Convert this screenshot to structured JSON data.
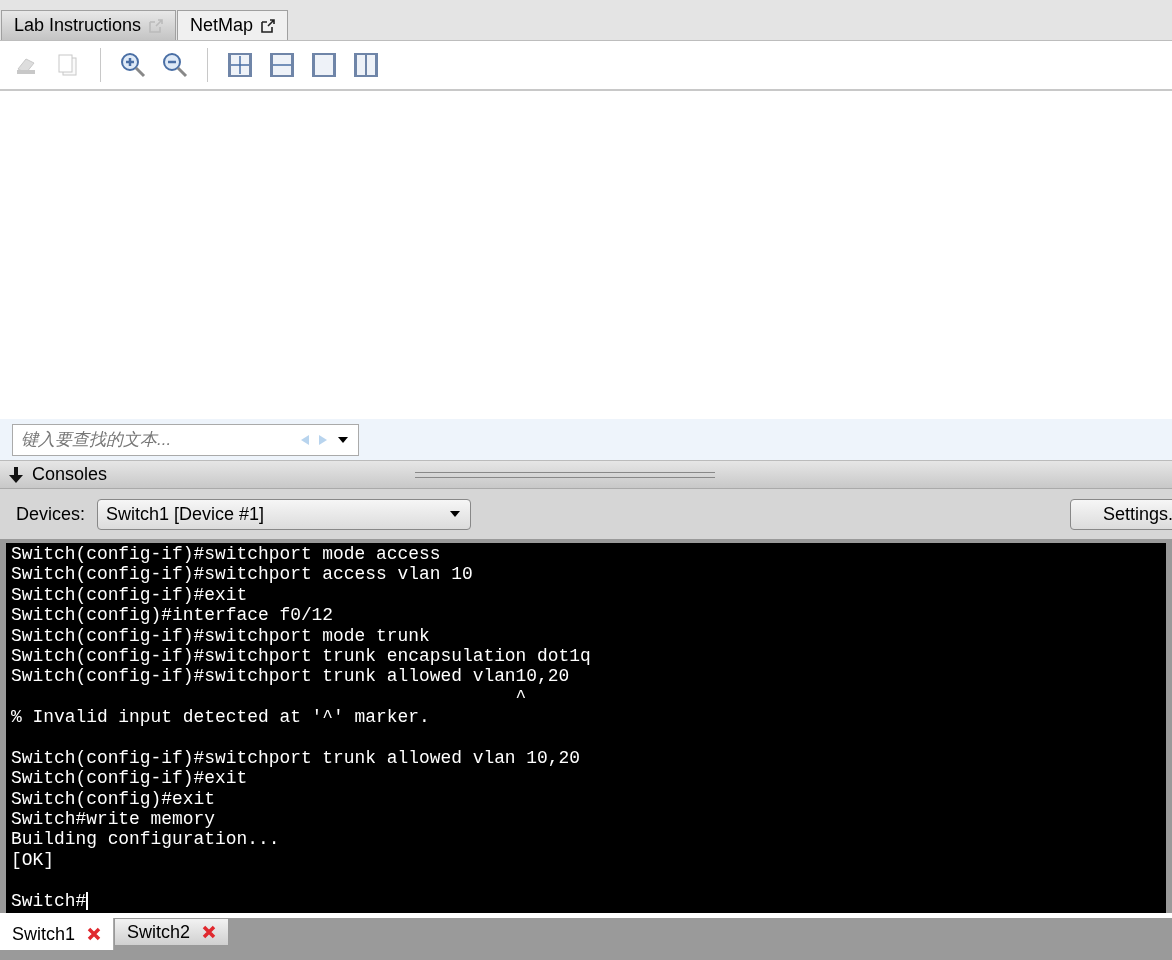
{
  "tabs": [
    {
      "label": "Lab Instructions",
      "selected": false
    },
    {
      "label": "NetMap",
      "selected": true
    }
  ],
  "toolbar": [
    {
      "kind": "print",
      "disabled": true
    },
    {
      "kind": "copy",
      "disabled": true
    },
    {
      "kind": "separator"
    },
    {
      "kind": "zoom-in",
      "disabled": false
    },
    {
      "kind": "zoom-out",
      "disabled": false
    },
    {
      "kind": "separator"
    },
    {
      "kind": "fit",
      "disabled": false
    },
    {
      "kind": "fit-width",
      "disabled": false
    },
    {
      "kind": "one-page",
      "disabled": false
    },
    {
      "kind": "two-page",
      "disabled": false
    }
  ],
  "search": {
    "placeholder": "键入要查找的文本..."
  },
  "consoles": {
    "title": "Consoles",
    "expanded": true,
    "devices_label": "Devices:",
    "device": "Switch1 [Device #1]",
    "settings_button": "Settings.",
    "lines": [
      {
        "kind": "text",
        "text": "Switch(config-if)#switchport mode access"
      },
      {
        "kind": "text",
        "text": "Switch(config-if)#switchport access vlan 10"
      },
      {
        "kind": "text",
        "text": "Switch(config-if)#exit"
      },
      {
        "kind": "text",
        "text": "Switch(config)#interface f0/12"
      },
      {
        "kind": "text",
        "text": "Switch(config-if)#switchport mode trunk"
      },
      {
        "kind": "text",
        "text": "Switch(config-if)#switchport trunk encapsulation dot1q"
      },
      {
        "kind": "text",
        "text": "Switch(config-if)#switchport trunk allowed vlan10,20"
      },
      {
        "kind": "text",
        "text": "                                               ^"
      },
      {
        "kind": "text",
        "text": "% Invalid input detected at '^' marker."
      },
      {
        "kind": "blank"
      },
      {
        "kind": "text",
        "text": "Switch(config-if)#switchport trunk allowed vlan 10,20"
      },
      {
        "kind": "text",
        "text": "Switch(config-if)#exit"
      },
      {
        "kind": "text",
        "text": "Switch(config)#exit"
      },
      {
        "kind": "text",
        "text": "Switch#write memory"
      },
      {
        "kind": "text",
        "text": "Building configuration..."
      },
      {
        "kind": "text",
        "text": "[OK]"
      },
      {
        "kind": "blank"
      },
      {
        "kind": "prompt",
        "text": "Switch#"
      }
    ]
  },
  "console_tabs": [
    {
      "label": "Switch1",
      "selected": true
    },
    {
      "label": "Switch2",
      "selected": false
    }
  ]
}
